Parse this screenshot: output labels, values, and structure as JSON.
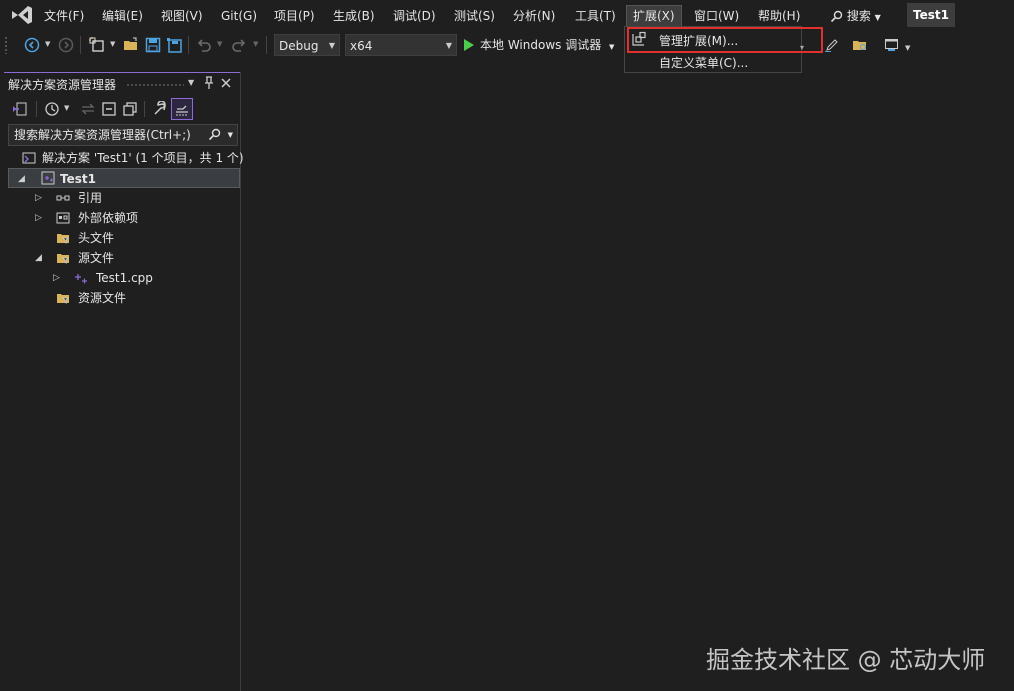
{
  "menubar": {
    "items": [
      {
        "label": "文件(F)"
      },
      {
        "label": "编辑(E)"
      },
      {
        "label": "视图(V)"
      },
      {
        "label": "Git(G)"
      },
      {
        "label": "项目(P)"
      },
      {
        "label": "生成(B)"
      },
      {
        "label": "调试(D)"
      },
      {
        "label": "测试(S)"
      },
      {
        "label": "分析(N)"
      },
      {
        "label": "工具(T)"
      },
      {
        "label": "扩展(X)"
      },
      {
        "label": "窗口(W)"
      },
      {
        "label": "帮助(H)"
      }
    ],
    "search_label": "搜索",
    "solution_name": "Test1"
  },
  "toolbar": {
    "config_value": "Debug",
    "platform_value": "x64",
    "run_label": "本地 Windows 调试器"
  },
  "extensions_menu": {
    "items": [
      {
        "label": "管理扩展(M)..."
      },
      {
        "label": "自定义菜单(C)..."
      }
    ]
  },
  "solution_explorer": {
    "title": "解决方案资源管理器",
    "search_placeholder": "搜索解决方案资源管理器(Ctrl+;)",
    "tree": [
      {
        "label": "解决方案 'Test1' (1 个项目，共 1 个)"
      },
      {
        "label": "Test1"
      },
      {
        "label": "引用"
      },
      {
        "label": "外部依赖项"
      },
      {
        "label": "头文件"
      },
      {
        "label": "源文件"
      },
      {
        "label": "Test1.cpp"
      },
      {
        "label": "资源文件"
      }
    ]
  },
  "watermark": "掘金技术社区 @ 芯动大师",
  "colors": {
    "accent_purple": "#8f6bd8",
    "highlight_red": "#e03030",
    "run_green": "#4ec94e",
    "folder_yellow": "#d9b35a"
  }
}
